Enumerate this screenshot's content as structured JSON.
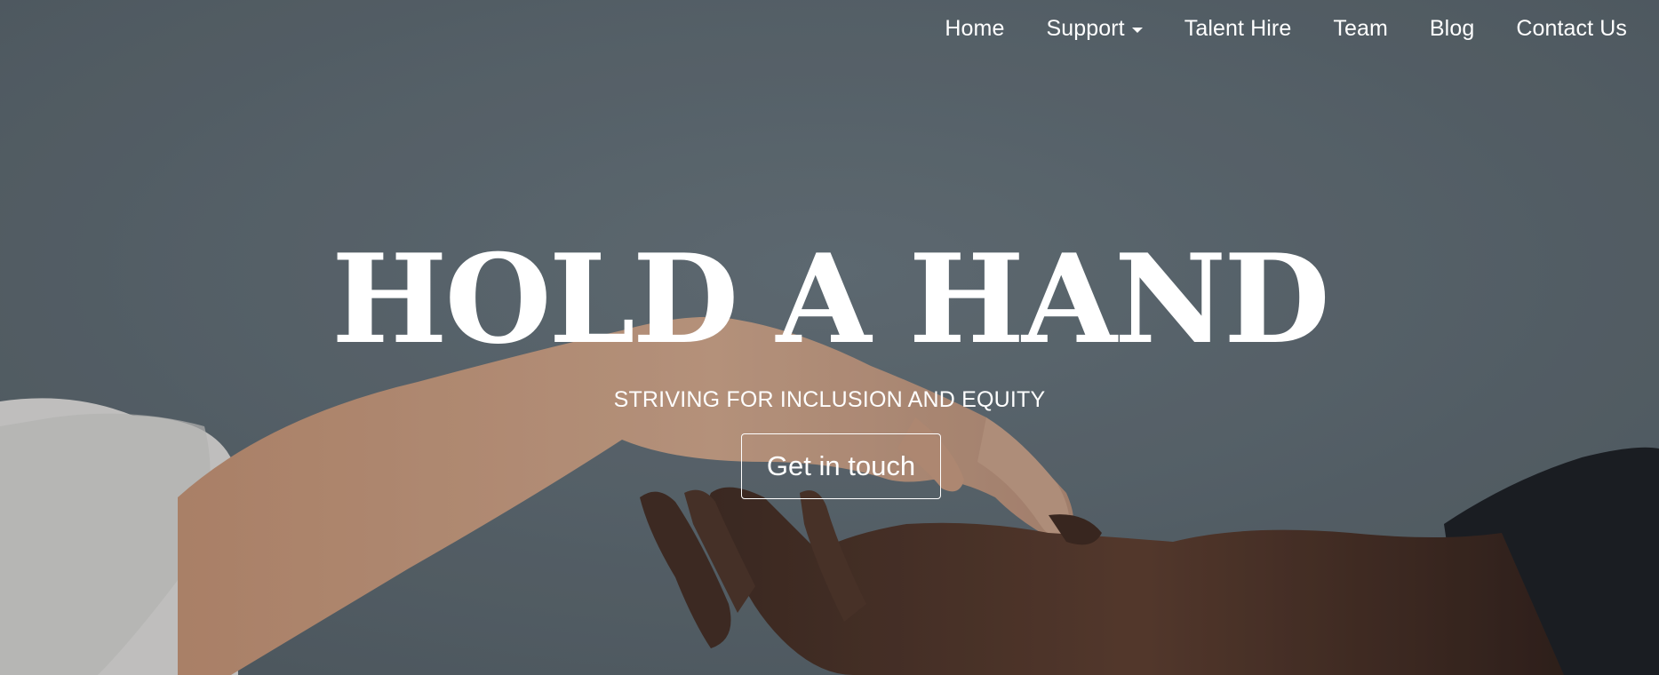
{
  "nav": {
    "items": [
      {
        "label": "Home"
      },
      {
        "label": "Support",
        "has_dropdown": true
      },
      {
        "label": "Talent Hire"
      },
      {
        "label": "Team"
      },
      {
        "label": "Blog"
      },
      {
        "label": "Contact Us"
      }
    ]
  },
  "hero": {
    "headline": "HOLD A HAND",
    "tagline": "STRIVING FOR INCLUSION AND EQUITY",
    "cta_label": "Get in touch",
    "background_colors": {
      "backdrop": "#5b666c",
      "light_skin": "#c99c7e",
      "dark_skin": "#4a2e20",
      "sleeve_white": "#e8e6e3",
      "sleeve_black": "#14171a"
    }
  }
}
